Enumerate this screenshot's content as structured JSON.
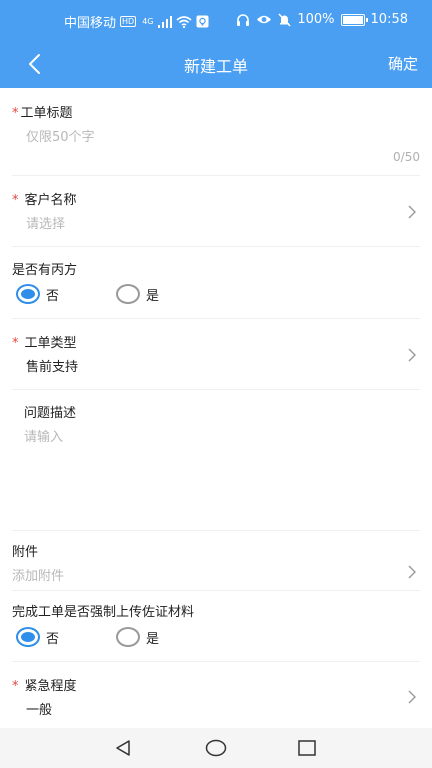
{
  "status_bar": {
    "carrier": "中国移动",
    "hd": "HD",
    "network": "4G",
    "battery": "100%",
    "battery_level": 1.0,
    "time": "10:58"
  },
  "navbar": {
    "title": "新建工单",
    "confirm_label": "确定",
    "back_icon": "chevron-left-icon"
  },
  "form": {
    "required_mark": "*",
    "title_field": {
      "label": "工单标题",
      "placeholder": "仅限50个字",
      "counter": "0/50"
    },
    "customer_field": {
      "label": "客户名称",
      "placeholder": "请选择"
    },
    "third_party": {
      "label": "是否有丙方",
      "options": [
        "否",
        "是"
      ],
      "selected": "否"
    },
    "type_field": {
      "label": "工单类型",
      "value": "售前支持"
    },
    "description_field": {
      "label": "问题描述",
      "placeholder": "请输入"
    },
    "attachment_field": {
      "label": "附件",
      "placeholder": "添加附件"
    },
    "force_upload": {
      "label": "完成工单是否强制上传佐证材料",
      "options": [
        "否",
        "是"
      ],
      "selected": "否"
    },
    "urgency_field": {
      "label": "紧急程度",
      "value": "一般"
    }
  },
  "colors": {
    "brand": "#4a9ff2",
    "radio_active": "#2f8ee9",
    "required": "#e8453c"
  }
}
